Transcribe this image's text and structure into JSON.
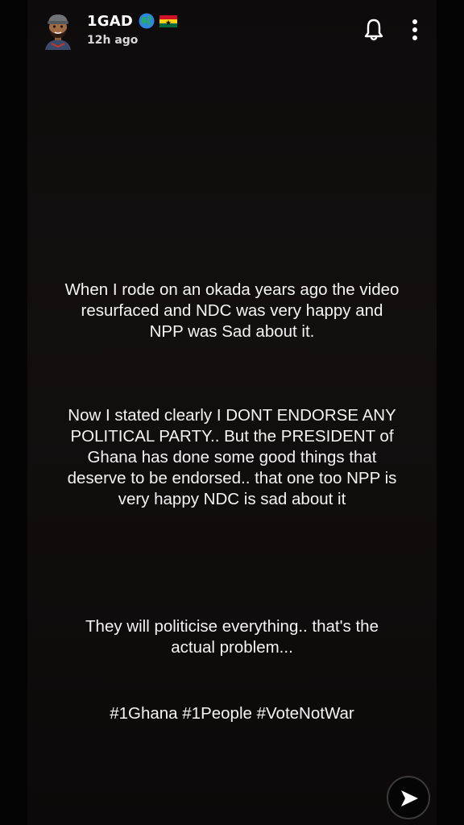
{
  "header": {
    "username": "1GAD",
    "timestamp": "12h ago",
    "icons": {
      "avatar": "bitmoji-avatar",
      "globe": "globe-emoji",
      "flag": "ghana-flag-emoji",
      "notification": "bell-icon",
      "menu": "more-vertical-icon"
    }
  },
  "story": {
    "paragraph_1": "When I rode on an okada years ago the video\nresurfaced and NDC was very happy and\nNPP was Sad about it.",
    "paragraph_2": "Now I stated clearly I DONT ENDORSE ANY\nPOLITICAL PARTY.. But the PRESIDENT of\nGhana has done some good things that\ndeserve to be endorsed.. that one too NPP is\nvery happy NDC is sad about it",
    "paragraph_3": "They will politicise everything.. that's the\nactual problem...",
    "hashtags": "#1Ghana #1People #VoteNotWar"
  },
  "footer": {
    "send_icon": "send-arrow-icon"
  },
  "colors": {
    "background": "#0a0a0a",
    "text": "#f4f4f4",
    "flag_red": "#ce1126",
    "flag_gold": "#fcd116",
    "flag_green": "#006b3f"
  }
}
